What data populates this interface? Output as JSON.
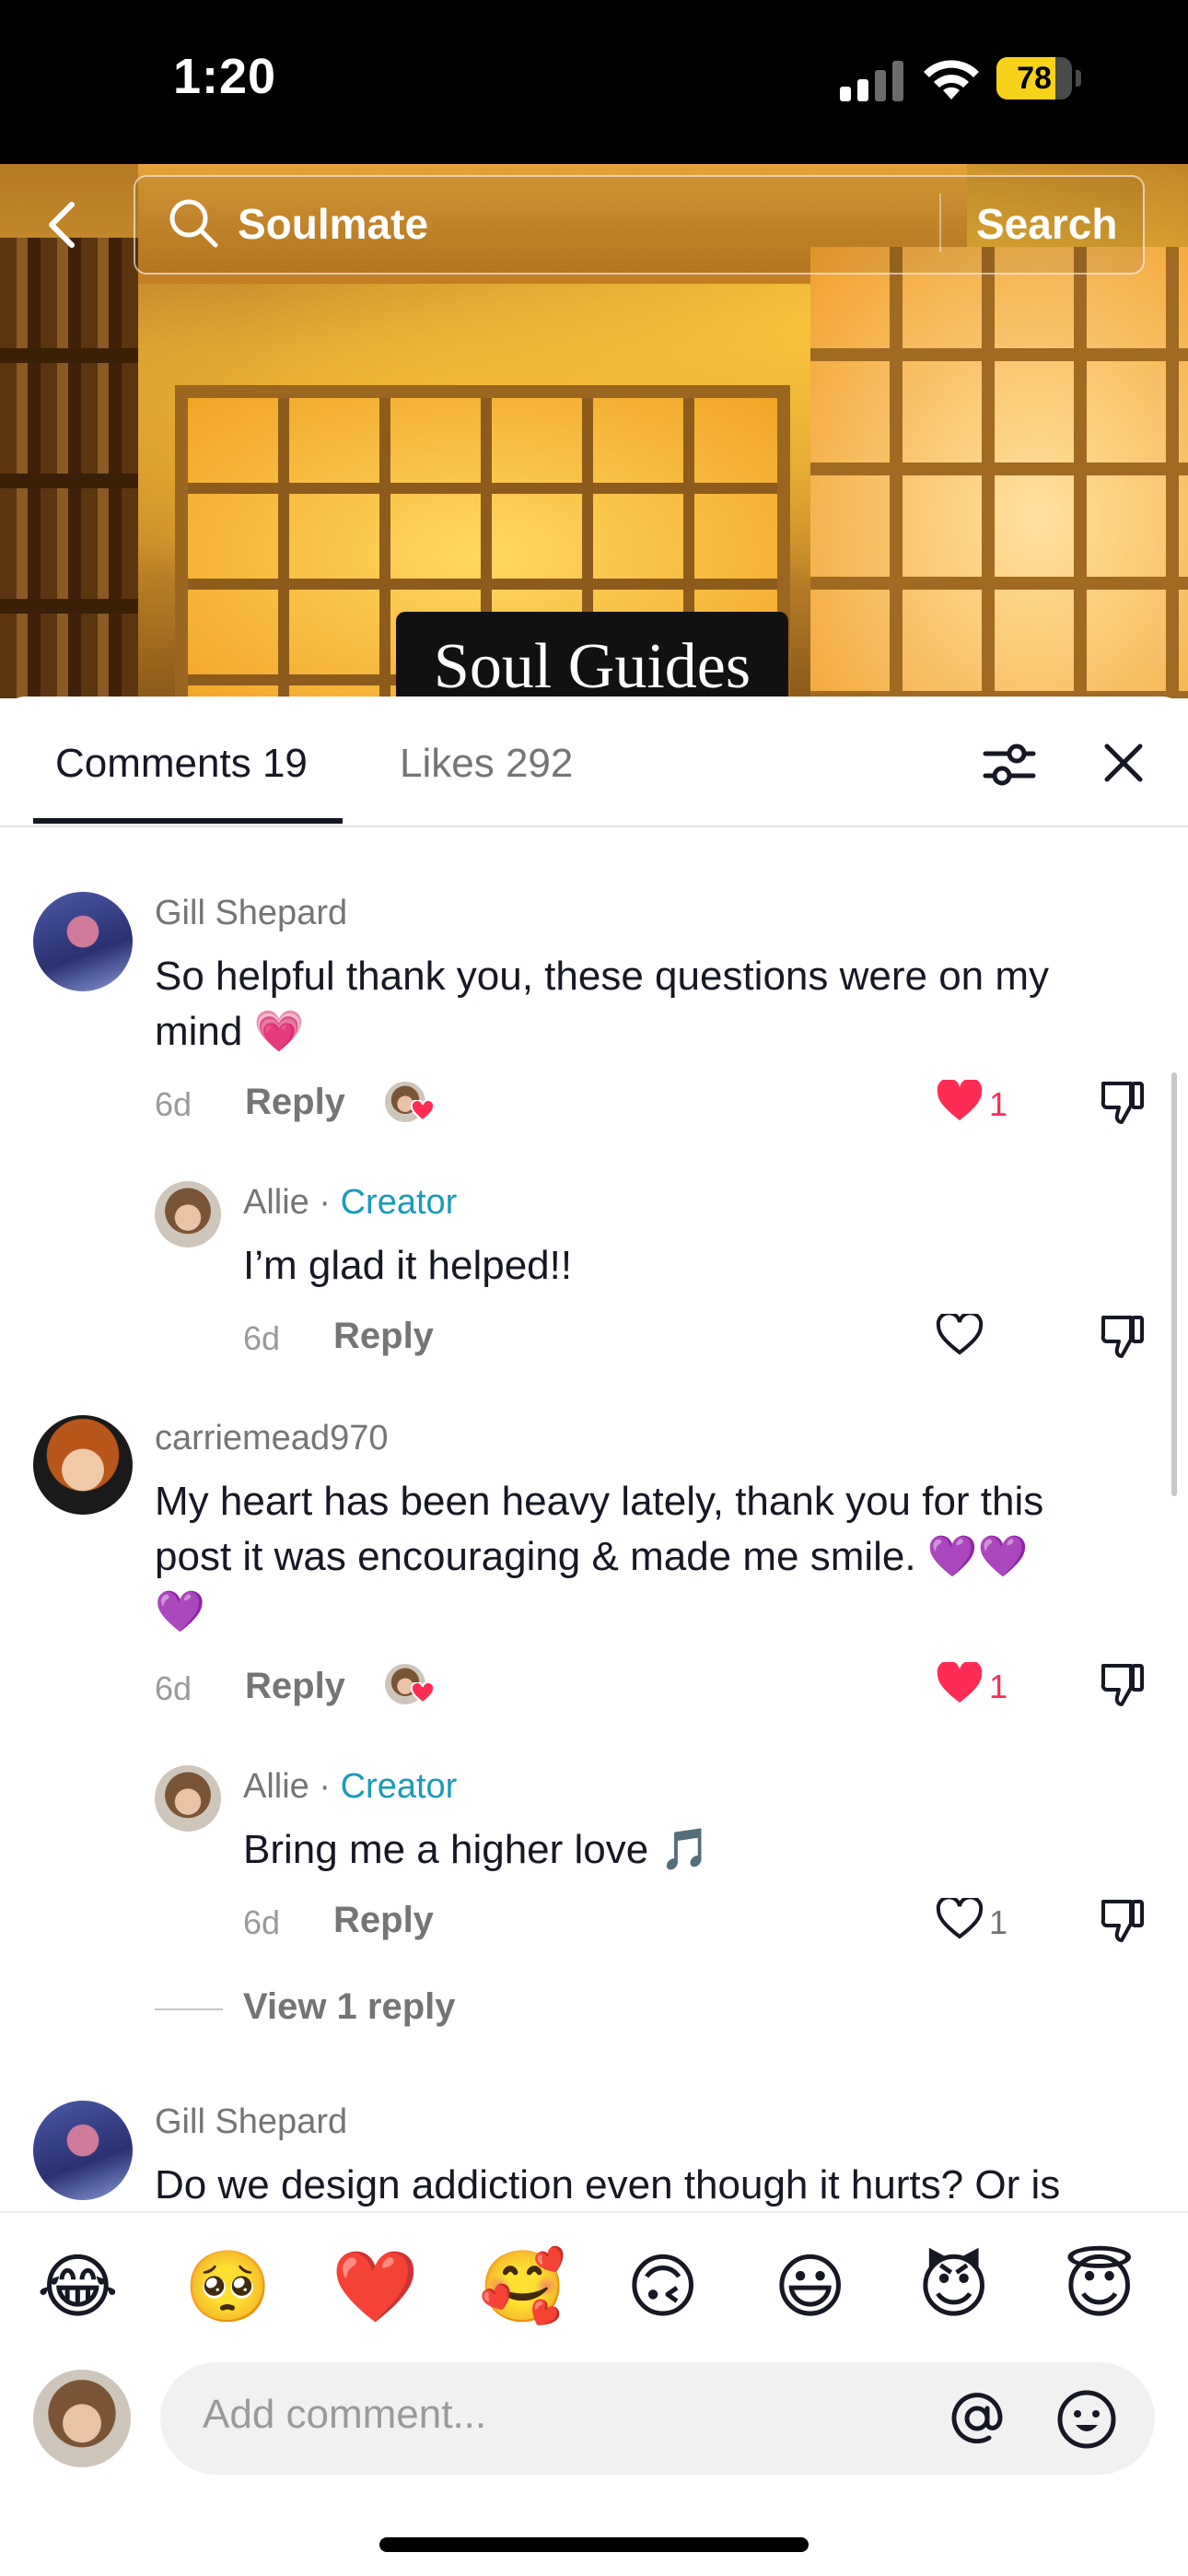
{
  "status_bar": {
    "time": "1:20",
    "battery": "78",
    "battery_level": 0.78
  },
  "search": {
    "query": "Soulmate",
    "button_label": "Search"
  },
  "video": {
    "caption": "Soul Guides"
  },
  "tabs": {
    "comments_label": "Comments 19",
    "likes_label": "Likes 292"
  },
  "comments": [
    {
      "username": "Gill Shepard",
      "text_lines": [
        "So helpful thank you, these questions were on my",
        "mind 💗"
      ],
      "age": "6d",
      "reply_label": "Reply",
      "likes": "1",
      "liked_by_creator": true,
      "liked": true
    },
    {
      "username": "Allie",
      "role": "Creator",
      "text_lines": [
        "I’m glad it helped!!"
      ],
      "age": "6d",
      "reply_label": "Reply",
      "likes": "",
      "liked": false
    },
    {
      "username": "carriemead970",
      "text_lines": [
        "My heart has been heavy lately, thank you for this",
        "post it was encouraging & made me smile. 💜💜",
        "💜"
      ],
      "age": "6d",
      "reply_label": "Reply",
      "likes": "1",
      "liked_by_creator": true,
      "liked": true
    },
    {
      "username": "Allie",
      "role": "Creator",
      "text_lines": [
        "Bring me a higher love 🎵"
      ],
      "age": "6d",
      "reply_label": "Reply",
      "likes": "1",
      "liked": false
    },
    {
      "username": "Gill Shepard",
      "text_lines": [
        "Do we design addiction even though it hurts? Or is"
      ]
    }
  ],
  "view_replies_label": "View 1 reply",
  "separator": "·",
  "emoji_bar": [
    "😂",
    "🥺",
    "❤️",
    "🥰",
    "🙃",
    "😃",
    "😈",
    "😇"
  ],
  "composer": {
    "placeholder": "Add comment..."
  },
  "colors": {
    "like_red": "#fe2c55",
    "creator_teal": "#1a9bb8",
    "battery_yellow": "#f7d21a"
  }
}
